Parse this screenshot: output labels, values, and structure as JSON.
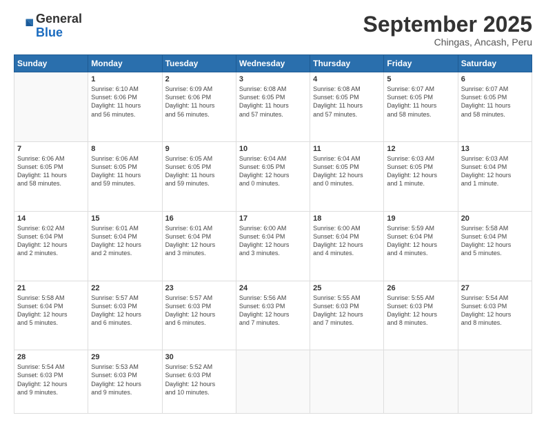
{
  "header": {
    "logo_general": "General",
    "logo_blue": "Blue",
    "month": "September 2025",
    "location": "Chingas, Ancash, Peru"
  },
  "days_of_week": [
    "Sunday",
    "Monday",
    "Tuesday",
    "Wednesday",
    "Thursday",
    "Friday",
    "Saturday"
  ],
  "weeks": [
    [
      {
        "day": "",
        "info": ""
      },
      {
        "day": "1",
        "info": "Sunrise: 6:10 AM\nSunset: 6:06 PM\nDaylight: 11 hours\nand 56 minutes."
      },
      {
        "day": "2",
        "info": "Sunrise: 6:09 AM\nSunset: 6:06 PM\nDaylight: 11 hours\nand 56 minutes."
      },
      {
        "day": "3",
        "info": "Sunrise: 6:08 AM\nSunset: 6:05 PM\nDaylight: 11 hours\nand 57 minutes."
      },
      {
        "day": "4",
        "info": "Sunrise: 6:08 AM\nSunset: 6:05 PM\nDaylight: 11 hours\nand 57 minutes."
      },
      {
        "day": "5",
        "info": "Sunrise: 6:07 AM\nSunset: 6:05 PM\nDaylight: 11 hours\nand 58 minutes."
      },
      {
        "day": "6",
        "info": "Sunrise: 6:07 AM\nSunset: 6:05 PM\nDaylight: 11 hours\nand 58 minutes."
      }
    ],
    [
      {
        "day": "7",
        "info": "Sunrise: 6:06 AM\nSunset: 6:05 PM\nDaylight: 11 hours\nand 58 minutes."
      },
      {
        "day": "8",
        "info": "Sunrise: 6:06 AM\nSunset: 6:05 PM\nDaylight: 11 hours\nand 59 minutes."
      },
      {
        "day": "9",
        "info": "Sunrise: 6:05 AM\nSunset: 6:05 PM\nDaylight: 11 hours\nand 59 minutes."
      },
      {
        "day": "10",
        "info": "Sunrise: 6:04 AM\nSunset: 6:05 PM\nDaylight: 12 hours\nand 0 minutes."
      },
      {
        "day": "11",
        "info": "Sunrise: 6:04 AM\nSunset: 6:05 PM\nDaylight: 12 hours\nand 0 minutes."
      },
      {
        "day": "12",
        "info": "Sunrise: 6:03 AM\nSunset: 6:05 PM\nDaylight: 12 hours\nand 1 minute."
      },
      {
        "day": "13",
        "info": "Sunrise: 6:03 AM\nSunset: 6:04 PM\nDaylight: 12 hours\nand 1 minute."
      }
    ],
    [
      {
        "day": "14",
        "info": "Sunrise: 6:02 AM\nSunset: 6:04 PM\nDaylight: 12 hours\nand 2 minutes."
      },
      {
        "day": "15",
        "info": "Sunrise: 6:01 AM\nSunset: 6:04 PM\nDaylight: 12 hours\nand 2 minutes."
      },
      {
        "day": "16",
        "info": "Sunrise: 6:01 AM\nSunset: 6:04 PM\nDaylight: 12 hours\nand 3 minutes."
      },
      {
        "day": "17",
        "info": "Sunrise: 6:00 AM\nSunset: 6:04 PM\nDaylight: 12 hours\nand 3 minutes."
      },
      {
        "day": "18",
        "info": "Sunrise: 6:00 AM\nSunset: 6:04 PM\nDaylight: 12 hours\nand 4 minutes."
      },
      {
        "day": "19",
        "info": "Sunrise: 5:59 AM\nSunset: 6:04 PM\nDaylight: 12 hours\nand 4 minutes."
      },
      {
        "day": "20",
        "info": "Sunrise: 5:58 AM\nSunset: 6:04 PM\nDaylight: 12 hours\nand 5 minutes."
      }
    ],
    [
      {
        "day": "21",
        "info": "Sunrise: 5:58 AM\nSunset: 6:04 PM\nDaylight: 12 hours\nand 5 minutes."
      },
      {
        "day": "22",
        "info": "Sunrise: 5:57 AM\nSunset: 6:03 PM\nDaylight: 12 hours\nand 6 minutes."
      },
      {
        "day": "23",
        "info": "Sunrise: 5:57 AM\nSunset: 6:03 PM\nDaylight: 12 hours\nand 6 minutes."
      },
      {
        "day": "24",
        "info": "Sunrise: 5:56 AM\nSunset: 6:03 PM\nDaylight: 12 hours\nand 7 minutes."
      },
      {
        "day": "25",
        "info": "Sunrise: 5:55 AM\nSunset: 6:03 PM\nDaylight: 12 hours\nand 7 minutes."
      },
      {
        "day": "26",
        "info": "Sunrise: 5:55 AM\nSunset: 6:03 PM\nDaylight: 12 hours\nand 8 minutes."
      },
      {
        "day": "27",
        "info": "Sunrise: 5:54 AM\nSunset: 6:03 PM\nDaylight: 12 hours\nand 8 minutes."
      }
    ],
    [
      {
        "day": "28",
        "info": "Sunrise: 5:54 AM\nSunset: 6:03 PM\nDaylight: 12 hours\nand 9 minutes."
      },
      {
        "day": "29",
        "info": "Sunrise: 5:53 AM\nSunset: 6:03 PM\nDaylight: 12 hours\nand 9 minutes."
      },
      {
        "day": "30",
        "info": "Sunrise: 5:52 AM\nSunset: 6:03 PM\nDaylight: 12 hours\nand 10 minutes."
      },
      {
        "day": "",
        "info": ""
      },
      {
        "day": "",
        "info": ""
      },
      {
        "day": "",
        "info": ""
      },
      {
        "day": "",
        "info": ""
      }
    ]
  ]
}
